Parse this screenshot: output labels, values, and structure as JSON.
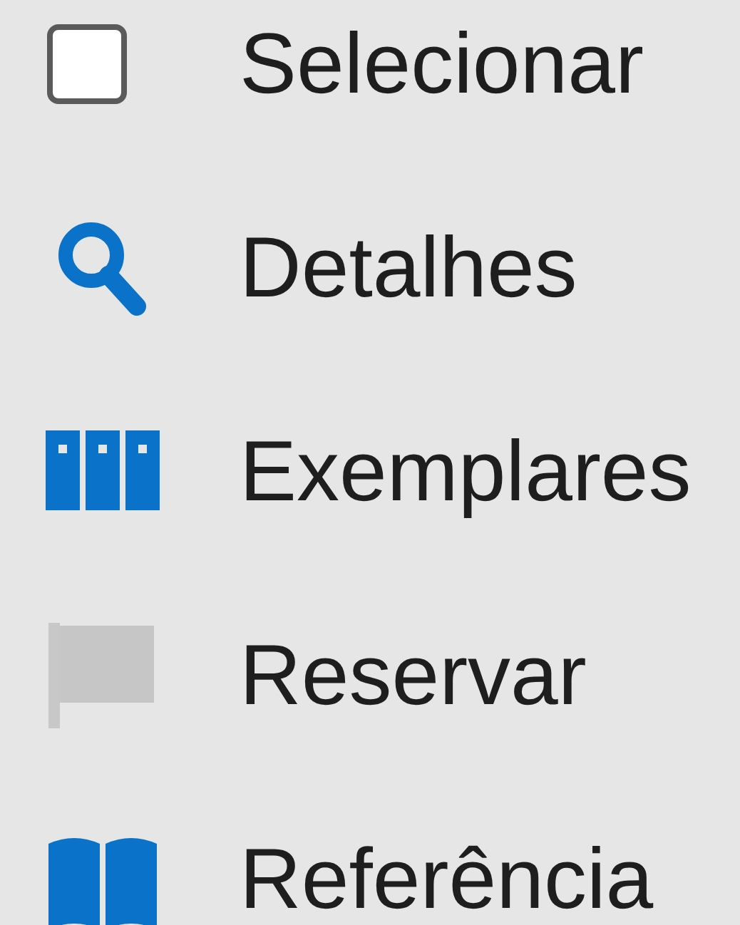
{
  "menu": {
    "items": [
      {
        "kind": "checkbox",
        "label": "Selecionar",
        "checked": false
      },
      {
        "kind": "search",
        "label": "Detalhes"
      },
      {
        "kind": "books",
        "label": "Exemplares"
      },
      {
        "kind": "flag",
        "label": "Reservar"
      },
      {
        "kind": "book",
        "label": "Referência"
      }
    ]
  }
}
